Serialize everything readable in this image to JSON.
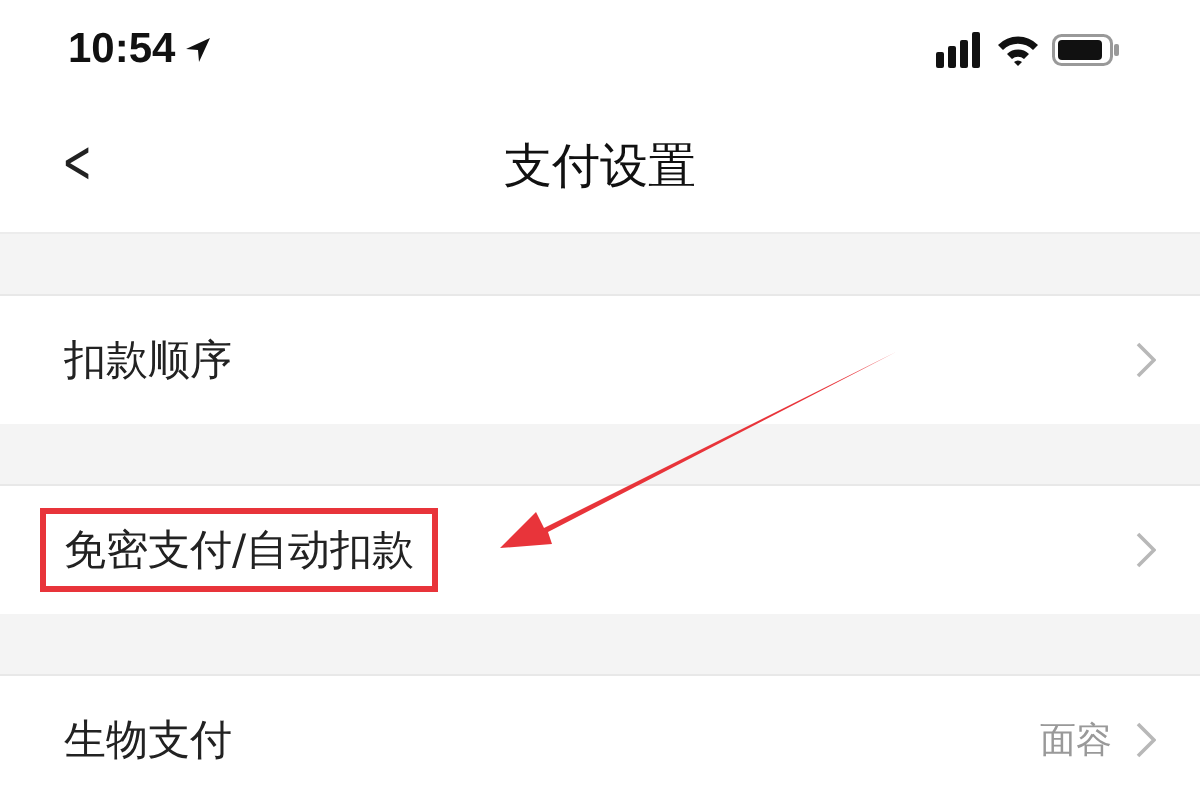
{
  "status_bar": {
    "time": "10:54"
  },
  "nav": {
    "back": "<",
    "title": "支付设置"
  },
  "items": [
    {
      "label": "扣款顺序",
      "highlighted": false
    },
    {
      "label": "免密支付/自动扣款",
      "highlighted": true
    },
    {
      "label": "生物支付",
      "value": "面容",
      "highlighted": false
    }
  ]
}
